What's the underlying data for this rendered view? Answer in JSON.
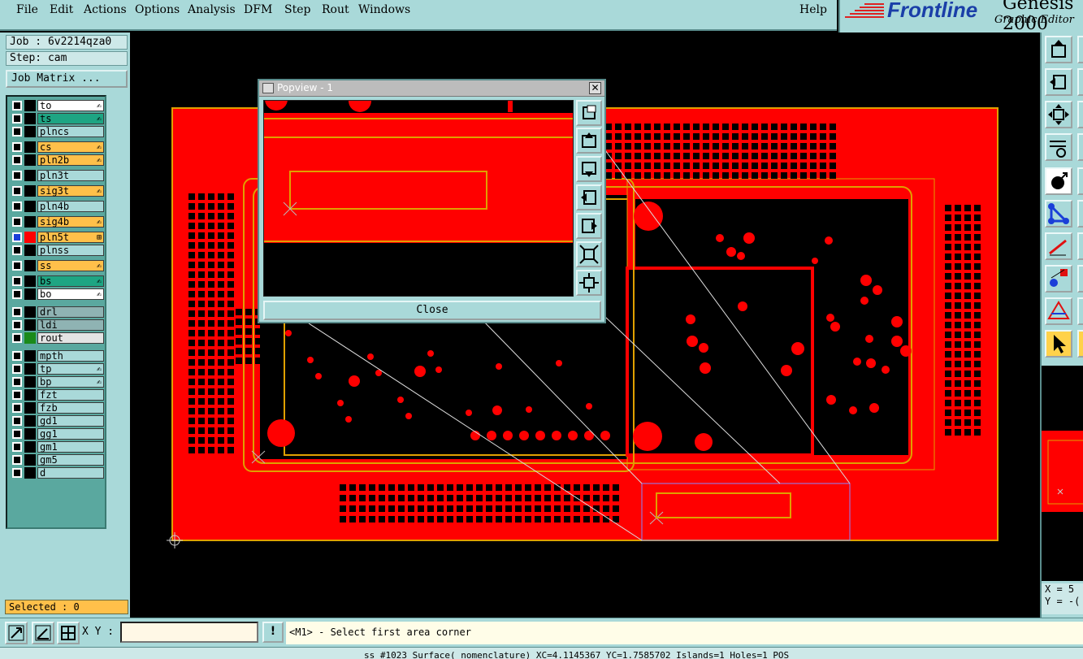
{
  "menu": {
    "items": [
      "File",
      "Edit",
      "Actions",
      "Options",
      "Analysis",
      "DFM",
      "Step",
      "Rout",
      "Windows"
    ],
    "help": "Help"
  },
  "brand": {
    "logo": "Frontline",
    "product": "Genesis 2000",
    "subtitle": "Graphic Editor"
  },
  "job": {
    "job_line": "Job : 6v2214qza0",
    "step_line": "Step: cam",
    "matrix_button": "Job Matrix ..."
  },
  "layers": [
    {
      "name": "to",
      "color": "#ffffff",
      "swatch": "#000000",
      "icon": "✍"
    },
    {
      "name": "ts",
      "color": "#1ea583",
      "swatch": "#000000",
      "icon": "✍"
    },
    {
      "name": "plncs",
      "color": "#a9d9d9",
      "swatch": "#000000",
      "icon": ""
    },
    {
      "name": "cs",
      "color": "#ffc04a",
      "swatch": "#000000",
      "icon": "✍"
    },
    {
      "name": "pln2b",
      "color": "#ffc04a",
      "swatch": "#000000",
      "icon": "✍"
    },
    {
      "name": "pln3t",
      "color": "#a9d9d9",
      "swatch": "#000000",
      "icon": ""
    },
    {
      "name": "sig3t",
      "color": "#ffc04a",
      "swatch": "#000000",
      "icon": "✍"
    },
    {
      "name": "pln4b",
      "color": "#a9d9d9",
      "swatch": "#000000",
      "icon": ""
    },
    {
      "name": "sig4b",
      "color": "#ffc04a",
      "swatch": "#000000",
      "icon": "✍"
    },
    {
      "name": "pln5t",
      "color": "#ffc04a",
      "swatch": "#ff0000",
      "icon": "⊞",
      "active": true
    },
    {
      "name": "plnss",
      "color": "#a9d9d9",
      "swatch": "#000000",
      "icon": ""
    },
    {
      "name": "ss",
      "color": "#ffc04a",
      "swatch": "#000000",
      "icon": "✍"
    },
    {
      "name": "bs",
      "color": "#1ea583",
      "swatch": "#000000",
      "icon": "✍"
    },
    {
      "name": "bo",
      "color": "#ffffff",
      "swatch": "#000000",
      "icon": "✍"
    },
    {
      "name": "drl",
      "color": "#8fb3b3",
      "swatch": "#000000",
      "icon": ""
    },
    {
      "name": "ldi",
      "color": "#8fb3b3",
      "swatch": "#000000",
      "icon": ""
    },
    {
      "name": "rout",
      "color": "#e4e4e4",
      "swatch": "#1a8a1a",
      "icon": ""
    },
    {
      "name": "mpth",
      "color": "#a9d9d9",
      "swatch": "#000000",
      "icon": ""
    },
    {
      "name": "tp",
      "color": "#a9d9d9",
      "swatch": "#000000",
      "icon": "✍"
    },
    {
      "name": "bp",
      "color": "#a9d9d9",
      "swatch": "#000000",
      "icon": "✍"
    },
    {
      "name": "fzt",
      "color": "#a9d9d9",
      "swatch": "#000000",
      "icon": ""
    },
    {
      "name": "fzb",
      "color": "#a9d9d9",
      "swatch": "#000000",
      "icon": ""
    },
    {
      "name": "gd1",
      "color": "#a9d9d9",
      "swatch": "#000000",
      "icon": ""
    },
    {
      "name": "gg1",
      "color": "#a9d9d9",
      "swatch": "#000000",
      "icon": ""
    },
    {
      "name": "gm1",
      "color": "#a9d9d9",
      "swatch": "#000000",
      "icon": ""
    },
    {
      "name": "gm5",
      "color": "#a9d9d9",
      "swatch": "#000000",
      "icon": ""
    },
    {
      "name": "d",
      "color": "#a9d9d9",
      "swatch": "#000000",
      "icon": ""
    }
  ],
  "selected": "Selected : 0",
  "popview": {
    "title": "Popview - 1",
    "close_x": "✕",
    "close_button": "Close",
    "buttons": [
      "zoom-fit-icon",
      "page-up-icon",
      "page-down-icon",
      "pan-left-icon",
      "pan-right-icon",
      "zoom-in-icon",
      "zoom-out-icon"
    ]
  },
  "right_tools": {
    "icons": [
      "home-icon",
      "zoom-area-icon",
      "fit-screen-icon",
      "measure-icon",
      "snap-icon",
      "connect-icon",
      "line-icon",
      "pad-icon",
      "triangle-icon",
      "pointer-icon"
    ],
    "coords": {
      "x": "X = 5",
      "y": "Y = -("
    }
  },
  "bottom": {
    "xy_label": "X Y :",
    "xy_value": "",
    "warn": "!",
    "prompt": "<M1> - Select first area corner"
  },
  "status": "ss #1023 Surface( nomenclature) XC=4.1145367 YC=1.7585702 Islands=1 Holes=1 POS",
  "colors": {
    "board": "#ff0000",
    "outline": "#e0a000",
    "panel": "#a9d9d9",
    "selected_bg": "#ffc04a"
  }
}
